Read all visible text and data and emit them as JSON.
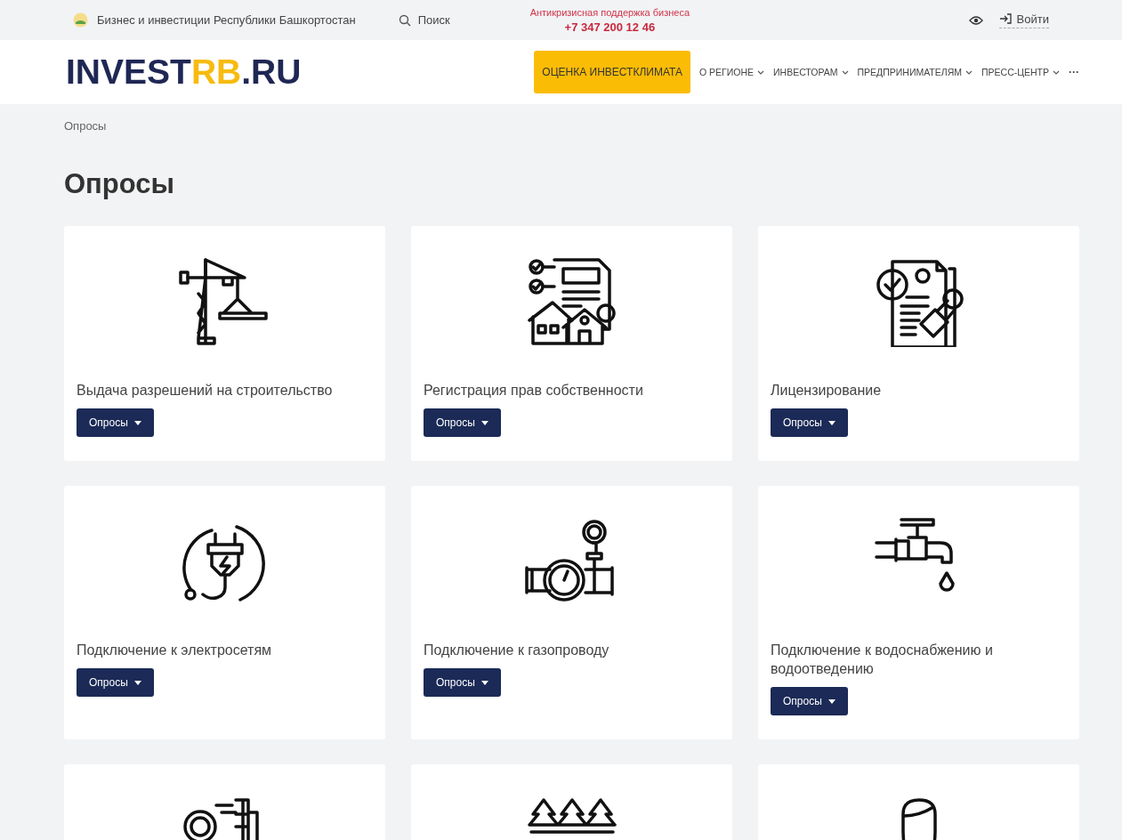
{
  "topbar": {
    "site_name": "Бизнес и инвестиции Республики Башкортостан",
    "search": "Поиск",
    "hotline_label": "Антикризисная поддержка бизнеса",
    "hotline_phone": "+7 347 200 12 46",
    "login": "Войти"
  },
  "header": {
    "logo": [
      {
        "text": "INVEST",
        "accent": false
      },
      {
        "text": "RB",
        "accent": true
      },
      {
        "text": ".RU",
        "accent": false
      }
    ],
    "cta": "ОЦЕНКА ИНВЕСТКЛИМАТА",
    "nav": [
      {
        "label": "О РЕГИОНЕ"
      },
      {
        "label": "ИНВЕСТОРАМ"
      },
      {
        "label": "ПРЕДПРИНИМАТЕЛЯМ"
      },
      {
        "label": "ПРЕСС-ЦЕНТР"
      }
    ],
    "more": "···"
  },
  "breadcrumb": "Опросы",
  "page_title": "Опросы",
  "cards": [
    {
      "kind": "crane",
      "title": "Выдача разрешений на строительство",
      "button": "Опросы"
    },
    {
      "kind": "property",
      "title": "Регистрация прав собственности",
      "button": "Опросы"
    },
    {
      "kind": "license",
      "title": "Лицензирование",
      "button": "Опросы"
    },
    {
      "kind": "plug",
      "title": "Подключение к электросетям",
      "button": "Опросы"
    },
    {
      "kind": "gas",
      "title": "Подключение к газопроводу",
      "button": "Опросы"
    },
    {
      "kind": "tap",
      "title": "Подключение к водоснабжению и водоотведению",
      "button": "Опросы"
    },
    {
      "kind": "industry"
    },
    {
      "kind": "forest"
    },
    {
      "kind": "person"
    }
  ]
}
